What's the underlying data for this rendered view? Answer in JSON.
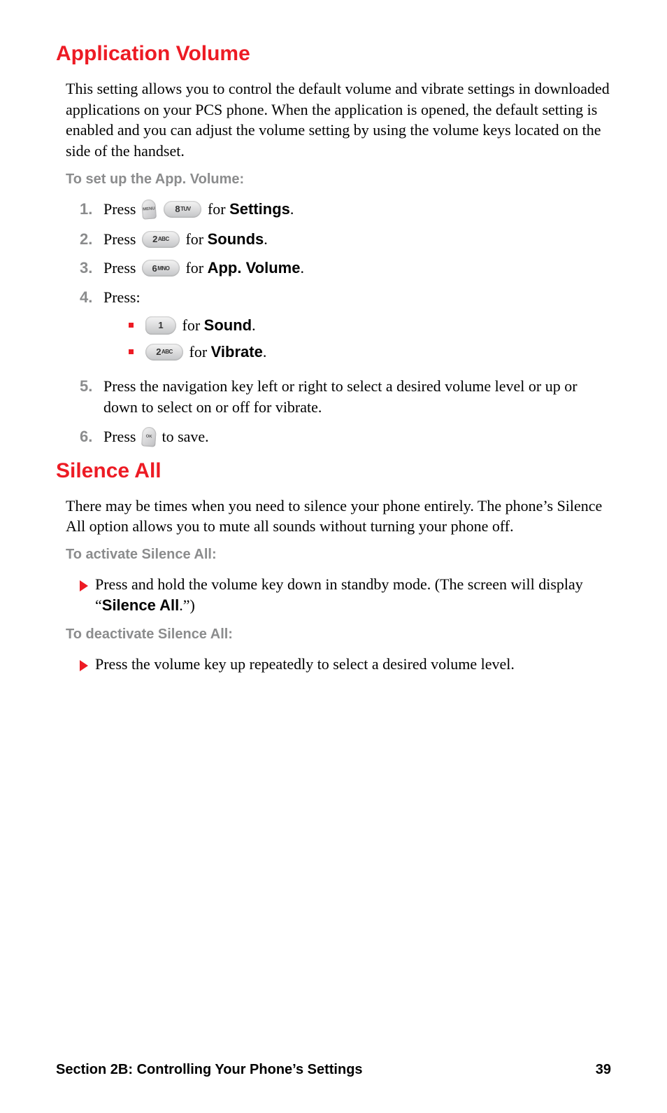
{
  "section1": {
    "heading": "Application Volume",
    "paragraph": "This setting allows you to control the default volume and vibrate settings in downloaded applications on your PCS phone. When the application is opened, the default setting is enabled and you can adjust the volume setting by using the volume keys located on the side of the handset.",
    "subheading": "To set up the App. Volume:",
    "steps": {
      "s1": {
        "num": "1.",
        "prefix": "Press ",
        "suffix": " for ",
        "term": "Settings",
        "period": "."
      },
      "s2": {
        "num": "2.",
        "prefix": "Press ",
        "suffix": " for ",
        "term": "Sounds",
        "period": "."
      },
      "s3": {
        "num": "3.",
        "prefix": "Press ",
        "suffix": " for ",
        "term": "App. Volume",
        "period": "."
      },
      "s4": {
        "num": "4.",
        "text": "Press:",
        "sub1": {
          "suffix": " for ",
          "term": "Sound",
          "period": "."
        },
        "sub2": {
          "suffix": " for ",
          "term": "Vibrate",
          "period": "."
        }
      },
      "s5": {
        "num": "5.",
        "text": "Press the navigation key left or right to select a desired volume level or up or down to select on or off for vibrate."
      },
      "s6": {
        "num": "6.",
        "prefix": "Press ",
        "suffix": " to save."
      }
    },
    "keys": {
      "k8": {
        "num": "8",
        "label": "TUV"
      },
      "k2": {
        "num": "2",
        "label": "ABC"
      },
      "k6": {
        "num": "6",
        "label": "MNO"
      },
      "k1": {
        "num": "1",
        "label": ""
      }
    }
  },
  "section2": {
    "heading": "Silence All",
    "paragraph": "There may be times when you need to silence your phone entirely. The phone’s Silence All option allows you to mute all sounds without turning your phone off.",
    "sub1": {
      "heading": "To activate Silence All:",
      "item_pre": "Press and hold the volume key down in standby mode. (The screen will display “",
      "item_term": "Silence All",
      "item_post": ".”)"
    },
    "sub2": {
      "heading": "To deactivate Silence All:",
      "item": "Press the volume key up repeatedly to select a desired volume level."
    }
  },
  "footer": {
    "left": "Section 2B: Controlling Your Phone’s Settings",
    "right": "39"
  }
}
